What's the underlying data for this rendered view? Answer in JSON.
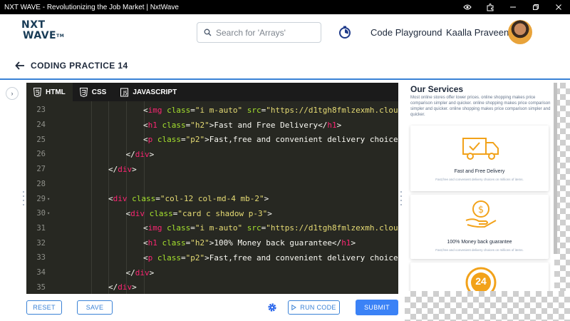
{
  "window": {
    "title": "NXT WAVE - Revolutionizing the Job Market | NxtWave"
  },
  "header": {
    "logo_line1": "NXT",
    "logo_line2": "WAVE",
    "logo_tm": "TM",
    "search_placeholder": "Search for 'Arrays'",
    "code_playground": "Code Playground",
    "user_name": "Kaalla Praveen"
  },
  "page": {
    "title": "CODING PRACTICE 14"
  },
  "editor": {
    "tabs": [
      {
        "label": "HTML",
        "active": true
      },
      {
        "label": "CSS",
        "active": false
      },
      {
        "label": "JAVASCRIPT",
        "active": false
      }
    ],
    "lines": [
      {
        "n": "23",
        "fold": "",
        "indent": 3,
        "code": "img_card1"
      },
      {
        "n": "24",
        "fold": "",
        "indent": 3,
        "code": "h1_card1"
      },
      {
        "n": "25",
        "fold": "",
        "indent": 3,
        "code": "p_card1"
      },
      {
        "n": "26",
        "fold": "",
        "indent": 2,
        "code": "close_div"
      },
      {
        "n": "27",
        "fold": "",
        "indent": 1,
        "code": "close_div"
      },
      {
        "n": "28",
        "fold": "",
        "indent": 0,
        "code": "empty"
      },
      {
        "n": "29",
        "fold": "▾",
        "indent": 1,
        "code": "div_col"
      },
      {
        "n": "30",
        "fold": "▾",
        "indent": 2,
        "code": "div_card"
      },
      {
        "n": "31",
        "fold": "",
        "indent": 3,
        "code": "img_card2"
      },
      {
        "n": "32",
        "fold": "",
        "indent": 3,
        "code": "h1_card2"
      },
      {
        "n": "33",
        "fold": "",
        "indent": 3,
        "code": "p_card2"
      },
      {
        "n": "34",
        "fold": "",
        "indent": 2,
        "code": "close_div"
      },
      {
        "n": "35",
        "fold": "",
        "indent": 1,
        "code": "close_div"
      }
    ],
    "strings": {
      "img_class": "\"i m-auto\"",
      "img_src": "\"https://d1tgh8fmlzexmh.cloud",
      "h2": "\"h2\"",
      "p2": "\"p2\"",
      "col_class": "\"col-12 col-md-4 mb-2\"",
      "card_class": "\"card c shadow p-3\"",
      "h1_text_1": "Fast and Free Delivery",
      "h1_text_2": "100% Money back guarantee",
      "p_text": "Fast,free and convenient delivery choices"
    }
  },
  "preview": {
    "title": "Our Services",
    "description": "Most online stores offer lower prices. online shopping makes price comparison simpler and quicker. online shopping makes price comparison simpler and quicker. online shopping makes price comparison simpler and quicker.",
    "cards": [
      {
        "icon": "delivery-truck-icon",
        "heading": "Fast and Free Delivery",
        "text": "Fast,free and convenient delivery choices on millions of items."
      },
      {
        "icon": "money-back-hand-icon",
        "heading": "100% Money back guarantee",
        "text": "Fast,free and convenient delivery choices on millions of items."
      },
      {
        "icon": "24-hours-icon",
        "heading": "",
        "text": "",
        "badge": "24"
      }
    ]
  },
  "controls": {
    "reset": "RESET",
    "save": "SAVE",
    "run_code": "RUN CODE",
    "submit": "SUBMIT"
  },
  "colors": {
    "accent": "#3b82f6",
    "icon_orange": "#f2a21a",
    "editor_bg": "#272822",
    "tag": "#f92672",
    "attr": "#a6e22e",
    "string": "#e6db74"
  }
}
